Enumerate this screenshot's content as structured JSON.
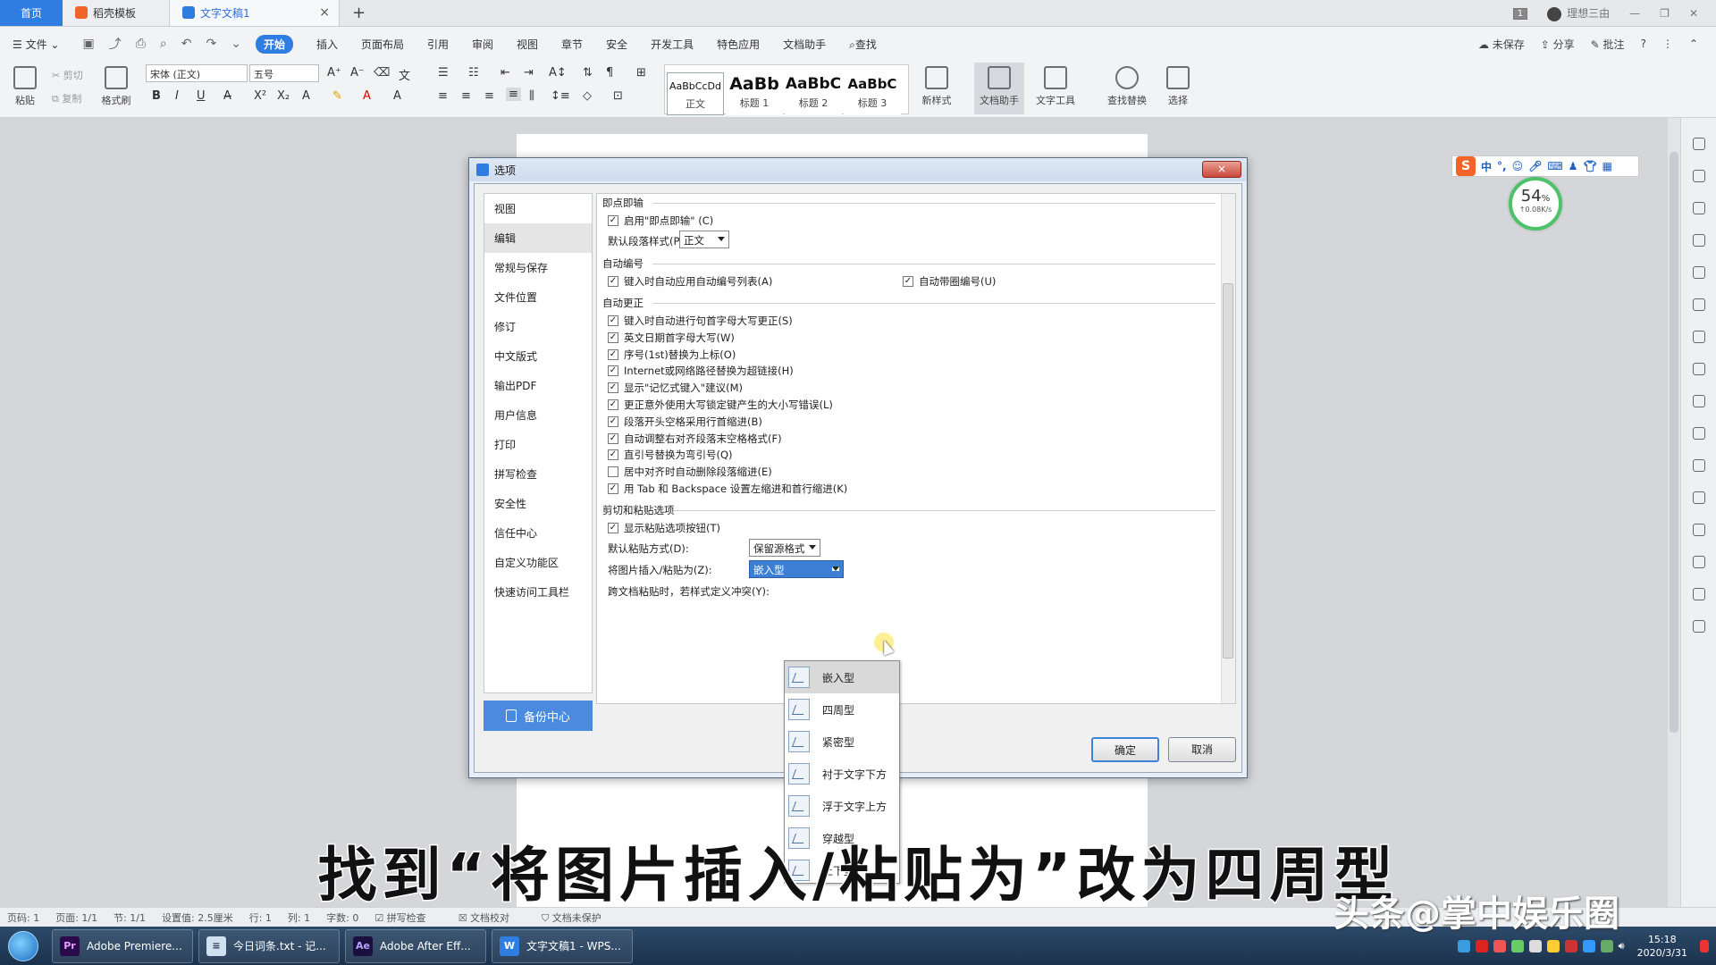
{
  "tabs": {
    "home": "首页",
    "template": "稻壳模板",
    "doc": "文字文稿1"
  },
  "window": {
    "page_badge": "1",
    "user": "理想三由"
  },
  "menu": [
    "文件",
    "开始",
    "插入",
    "页面布局",
    "引用",
    "审阅",
    "视图",
    "章节",
    "安全",
    "开发工具",
    "特色应用",
    "文档助手",
    "查找"
  ],
  "menu_right": [
    "未保存",
    "分享",
    "批注",
    "?"
  ],
  "ribbon": {
    "paste": "粘贴",
    "cut": "剪切",
    "copy": "复制",
    "format_painter": "格式刷",
    "font": "宋体 (正文)",
    "size": "五号",
    "styles": [
      {
        "preview": "AaBbCcDd",
        "name": "正文"
      },
      {
        "preview": "AaBb",
        "name": "标题 1"
      },
      {
        "preview": "AaBbC",
        "name": "标题 2"
      },
      {
        "preview": "AaBbC",
        "name": "标题 3"
      }
    ],
    "new_style": "新样式",
    "doc_assist": "文档助手",
    "text_tools": "文字工具",
    "find_replace": "查找替换",
    "select": "选择"
  },
  "dialog": {
    "title": "选项",
    "close": "×",
    "nav": [
      "视图",
      "编辑",
      "常规与保存",
      "文件位置",
      "修订",
      "中文版式",
      "输出PDF",
      "用户信息",
      "打印",
      "拼写检查",
      "安全性",
      "信任中心",
      "自定义功能区",
      "快速访问工具栏"
    ],
    "backup": "备份中心",
    "sections": {
      "s1": "即点即输",
      "s2": "自动编号",
      "s3": "自动更正",
      "s4": "剪切和粘贴选项"
    },
    "enable_click_type": "启用\"即点即输\" (C)",
    "default_para_label": "默认段落样式(P):",
    "default_para_value": "正文",
    "auto_num_list": "键入时自动应用自动编号列表(A)",
    "auto_circle": "自动带圈编号(U)",
    "autocorrect": [
      {
        "label": "键入时自动进行句首字母大写更正(S)",
        "checked": true
      },
      {
        "label": "英文日期首字母大写(W)",
        "checked": true
      },
      {
        "label": "序号(1st)替换为上标(O)",
        "checked": true
      },
      {
        "label": "Internet或网络路径替换为超链接(H)",
        "checked": true
      },
      {
        "label": "显示\"记忆式键入\"建议(M)",
        "checked": true
      },
      {
        "label": "更正意外使用大写锁定键产生的大小写错误(L)",
        "checked": true
      },
      {
        "label": "段落开头空格采用行首缩进(B)",
        "checked": true
      },
      {
        "label": "自动调整右对齐段落末空格格式(F)",
        "checked": true
      },
      {
        "label": "直引号替换为弯引号(Q)",
        "checked": true
      },
      {
        "label": "居中对齐时自动删除段落缩进(E)",
        "checked": false
      },
      {
        "label": "用 Tab 和 Backspace 设置左缩进和首行缩进(K)",
        "checked": true
      }
    ],
    "show_paste_btn": "显示粘贴选项按钮(T)",
    "default_paste_label": "默认粘贴方式(D):",
    "default_paste_value": "保留源格式",
    "insert_pic_label": "将图片插入/粘贴为(Z):",
    "insert_pic_value": "嵌入型",
    "cross_doc_label": "跨文档粘贴时，若样式定义冲突(Y):",
    "ok": "确定",
    "cancel": "取消"
  },
  "dropdown_options": [
    "嵌入型",
    "四周型",
    "紧密型",
    "衬于文字下方",
    "浮于文字上方",
    "穿越型",
    "上下型"
  ],
  "ime": {
    "logo": "S",
    "mode": "中",
    "punct": "°,"
  },
  "speed": {
    "percent": "54",
    "unit": "%",
    "rate": "↑0.08K/s"
  },
  "status": [
    "页码: 1",
    "页面: 1/1",
    "节: 1/1",
    "设置值: 2.5厘米",
    "行: 1",
    "列: 1",
    "字数: 0",
    "拼写检查",
    "文档校对",
    "文档未保护"
  ],
  "taskbar": [
    {
      "label": "Adobe Premiere...",
      "icon": "Pr",
      "color": "#2a0a4a",
      "fg": "#e6a0ff"
    },
    {
      "label": "今日词条.txt - 记...",
      "icon": "≡",
      "color": "#cfe0f0",
      "fg": "#335"
    },
    {
      "label": "Adobe After Eff...",
      "icon": "Ae",
      "color": "#1a1040",
      "fg": "#b8a2ff"
    },
    {
      "label": "文字文稿1 - WPS...",
      "icon": "W",
      "color": "#2f7de1",
      "fg": "#fff"
    }
  ],
  "clock": {
    "time": "15:18",
    "date": "2020/3/31"
  },
  "caption": "找到“将图片插入/粘贴为”改为四周型",
  "watermark": "头条@掌中娱乐圈"
}
